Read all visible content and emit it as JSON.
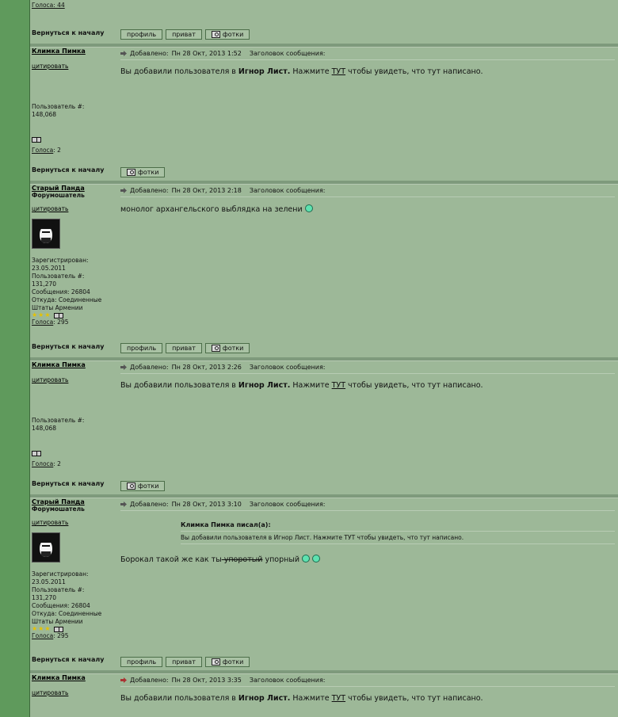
{
  "common": {
    "back_to_top": "Вернуться к началу",
    "quote": "цитировать",
    "posted_prefix": "Добавлено:",
    "subject_label": "Заголовок сообщения:",
    "votes_label": "Голоса",
    "buttons": {
      "profile": "профиль",
      "pm": "приват",
      "photos": "фотки"
    }
  },
  "top_stub": {
    "votes": "Голоса: 44"
  },
  "posts": [
    {
      "author": "Климка Пимка",
      "date": "Пн 28 Окт, 2013 1:52",
      "user_num_label": "Пользователь #:",
      "user_num": "148,068",
      "votes": ": 2",
      "message_pre": "Вы добавили пользователя в ",
      "message_bold": "Игнор Лист.",
      "message_mid": " Нажмите ",
      "message_link": "ТУТ",
      "message_post": " чтобы увидеть, что тут написано."
    },
    {
      "author": "Старый Панда",
      "rank": "Форумошатель",
      "date": "Пн 28 Окт, 2013 2:18",
      "registered": "Зарегистрирован:",
      "registered_date": "23.05.2011",
      "user_num_label": "Пользователь #:",
      "user_num": "131,270",
      "posts_count": "Сообщения: 26804",
      "from": "Откуда: Соединенные Штаты Армении",
      "votes": ": 295",
      "message": "монолог архангельского выблядка на зелени "
    },
    {
      "author": "Климка Пимка",
      "date": "Пн 28 Окт, 2013 2:26",
      "user_num_label": "Пользователь #:",
      "user_num": "148,068",
      "votes": ": 2",
      "message_pre": "Вы добавили пользователя в ",
      "message_bold": "Игнор Лист.",
      "message_mid": " Нажмите ",
      "message_link": "ТУТ",
      "message_post": " чтобы увидеть, что тут написано."
    },
    {
      "author": "Старый Панда",
      "rank": "Форумошатель",
      "date": "Пн 28 Окт, 2013 3:10",
      "registered": "Зарегистрирован:",
      "registered_date": "23.05.2011",
      "user_num_label": "Пользователь #:",
      "user_num": "131,270",
      "posts_count": "Сообщения: 26804",
      "from": "Откуда: Соединенные Штаты Армении",
      "votes": ": 295",
      "quote_author": "Климка Пимка писал(а):",
      "quote_text": "Вы добавили пользователя в Игнор Лист. Нажмите ТУТ чтобы увидеть, что тут написано.",
      "message_pre": "Борокал такой же как ты",
      "message_strike": " упоротый",
      "message_post": " упорный "
    },
    {
      "author": "Климка Пимка",
      "date": "Пн 28 Окт, 2013 3:35",
      "message_pre": "Вы добавили пользователя в ",
      "message_bold": "Игнор Лист.",
      "message_mid": " Нажмите ",
      "message_link": "ТУТ",
      "message_post": " чтобы увидеть, что тут написано."
    }
  ]
}
